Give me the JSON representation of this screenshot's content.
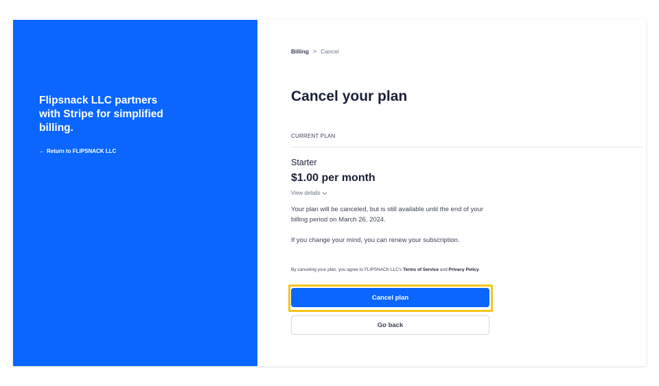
{
  "left": {
    "heading": "Flipsnack LLC partners with Stripe for simplified billing.",
    "return_link": "Return to FLIPSNACK LLC",
    "return_arrow": "←"
  },
  "breadcrumb": {
    "billing": "Billing",
    "separator": ">",
    "current": "Cancel"
  },
  "page": {
    "title": "Cancel your plan",
    "section_label": "CURRENT PLAN"
  },
  "plan": {
    "name": "Starter",
    "price": "$1.00 per month",
    "view_details": "View details",
    "view_details_icon": "chevron-down-icon"
  },
  "messages": {
    "availability": "Your plan will be canceled, but is still available until the end of your billing period on March 26, 2024.",
    "renew": "If you change your mind, you can renew your subscription."
  },
  "legal": {
    "prefix": "By canceling your plan, you agree to FLIPSNACK LLC's",
    "terms": "Terms of Service",
    "and": "and",
    "privacy": "Privacy Policy",
    "suffix": "."
  },
  "buttons": {
    "cancel_plan": "Cancel plan",
    "go_back": "Go back"
  },
  "colors": {
    "brand_blue": "#0a66ff",
    "highlight": "#f5c518"
  }
}
